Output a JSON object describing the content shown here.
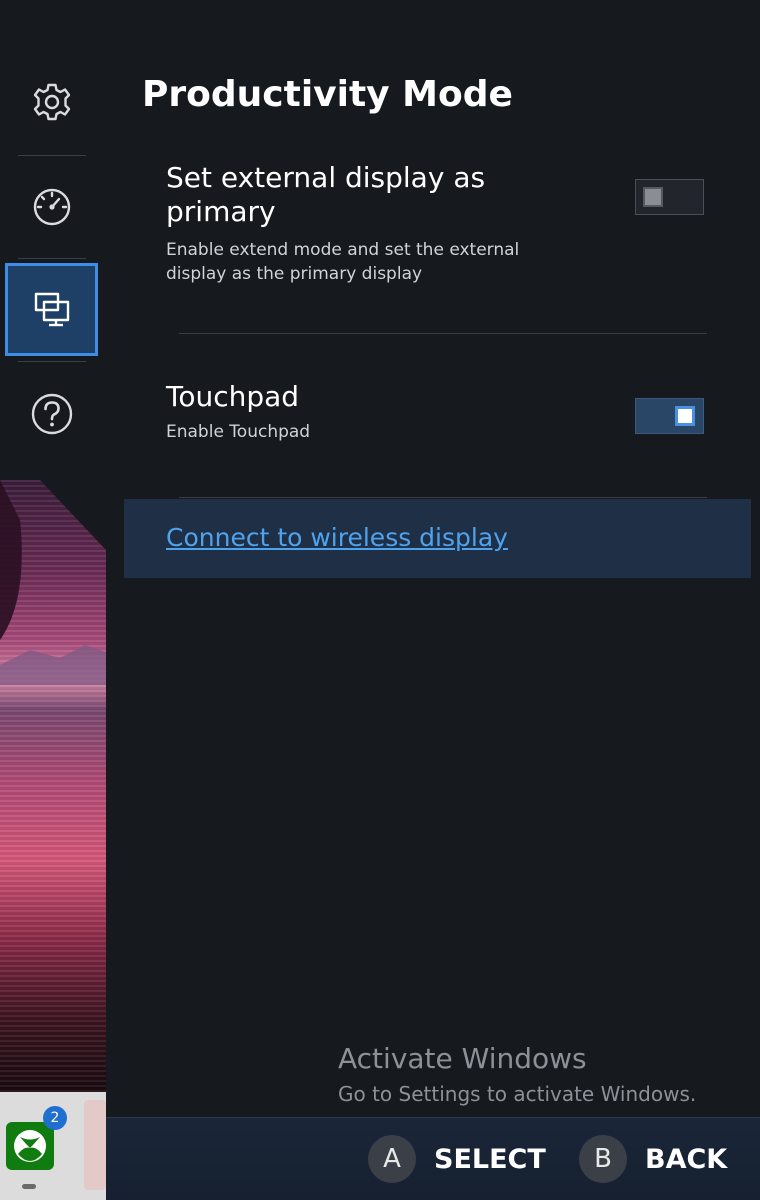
{
  "header": {
    "title": "Productivity Mode"
  },
  "sidebar": {
    "items": [
      {
        "icon": "gear-icon",
        "active": false
      },
      {
        "icon": "gauge-icon",
        "active": false
      },
      {
        "icon": "display-icon",
        "active": true
      },
      {
        "icon": "help-icon",
        "active": false
      }
    ]
  },
  "settings": {
    "external_display": {
      "title": "Set external display as primary",
      "description": "Enable extend mode and set the external display as the primary display",
      "enabled": false
    },
    "touchpad": {
      "title": "Touchpad",
      "description": "Enable Touchpad",
      "enabled": true
    },
    "wireless_link": "Connect to wireless display"
  },
  "watermark": {
    "title": "Activate Windows",
    "subtitle": "Go to Settings to activate Windows."
  },
  "taskbar": {
    "xbox_badge": "2"
  },
  "footer": {
    "select_key": "A",
    "select_label": "SELECT",
    "back_key": "B",
    "back_label": "BACK"
  },
  "colors": {
    "accent": "#3d8ee6",
    "link": "#4ea3ef",
    "background": "#16191e",
    "xbox_green": "#107c10"
  }
}
